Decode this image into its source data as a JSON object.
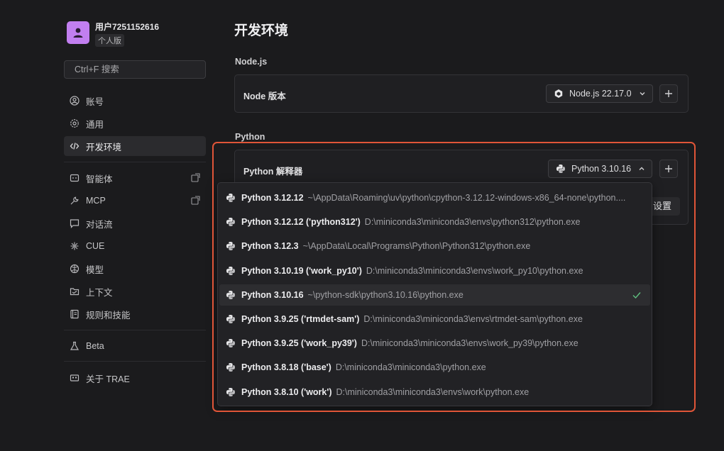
{
  "user": {
    "name": "用户7251152616",
    "plan": "个人版"
  },
  "search": {
    "placeholder": "Ctrl+F 搜索"
  },
  "sidebar": {
    "items": [
      {
        "label": "账号"
      },
      {
        "label": "通用"
      },
      {
        "label": "开发环境"
      },
      {
        "label": "智能体"
      },
      {
        "label": "MCP"
      },
      {
        "label": "对话流"
      },
      {
        "label": "CUE"
      },
      {
        "label": "模型"
      },
      {
        "label": "上下文"
      },
      {
        "label": "规则和技能"
      },
      {
        "label": "Beta"
      },
      {
        "label": "关于 TRAE"
      }
    ]
  },
  "main": {
    "title": "开发环境",
    "node": {
      "section": "Node.js",
      "row_label": "Node 版本",
      "selected": "Node.js 22.17.0"
    },
    "python": {
      "section": "Python",
      "row_label": "Python 解释器",
      "selected": "Python 3.10.16",
      "settings_label": "设置"
    }
  },
  "dropdown": {
    "options": [
      {
        "name": "Python 3.12.12",
        "path": "~\\AppData\\Roaming\\uv\\python\\cpython-3.12.12-windows-x86_64-none\\python...."
      },
      {
        "name": "Python 3.12.12 ('python312')",
        "path": "D:\\miniconda3\\miniconda3\\envs\\python312\\python.exe"
      },
      {
        "name": "Python 3.12.3",
        "path": "~\\AppData\\Local\\Programs\\Python\\Python312\\python.exe"
      },
      {
        "name": "Python 3.10.19 ('work_py10')",
        "path": "D:\\miniconda3\\miniconda3\\envs\\work_py10\\python.exe"
      },
      {
        "name": "Python 3.10.16",
        "path": "~\\python-sdk\\python3.10.16\\python.exe"
      },
      {
        "name": "Python 3.9.25 ('rtmdet-sam')",
        "path": "D:\\miniconda3\\miniconda3\\envs\\rtmdet-sam\\python.exe"
      },
      {
        "name": "Python 3.9.25 ('work_py39')",
        "path": "D:\\miniconda3\\miniconda3\\envs\\work_py39\\python.exe"
      },
      {
        "name": "Python 3.8.18 ('base')",
        "path": "D:\\miniconda3\\miniconda3\\python.exe"
      },
      {
        "name": "Python 3.8.10 ('work')",
        "path": "D:\\miniconda3\\miniconda3\\envs\\work\\python.exe"
      }
    ]
  },
  "colors": {
    "highlight": "#e05538",
    "avatar": "#c27ff0",
    "check": "#5fbf7f"
  }
}
